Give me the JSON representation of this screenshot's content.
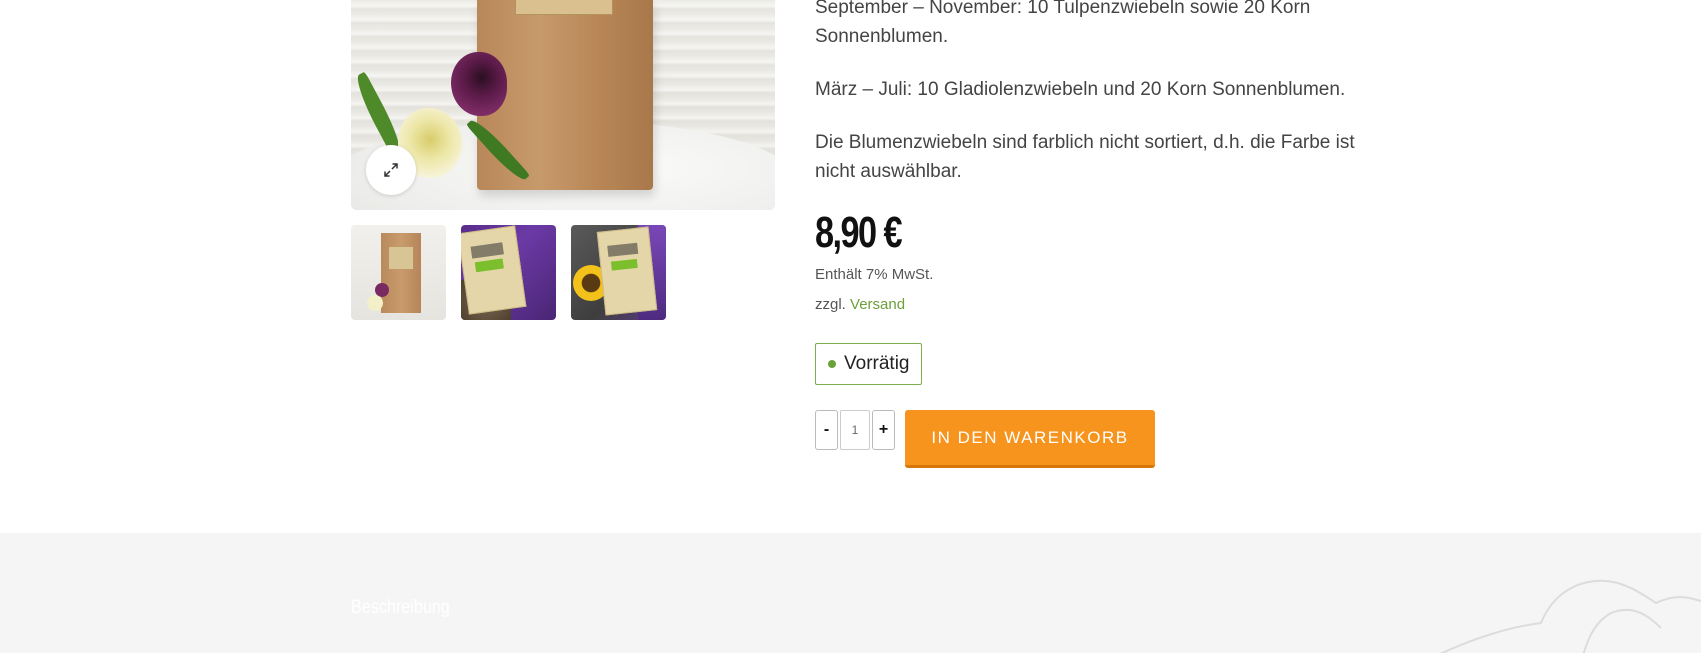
{
  "gallery": {
    "main_image_alt": "Papiertüte mit Tulpen",
    "zoom_icon": "expand-icon",
    "thumbnails": [
      {
        "alt": "Papiertüte mit Tulpen"
      },
      {
        "alt": "Karte mit Gladiolen"
      },
      {
        "alt": "Karte mit Sonnenblume und Gladiolen"
      }
    ]
  },
  "product": {
    "description": [
      "September – November: 10 Tulpenzwiebeln sowie 20 Korn Sonnenblumen.",
      "März – Juli: 10 Gladiolenzwiebeln und 20 Korn Sonnenblumen.",
      "Die Blumenzwiebeln sind farblich nicht sortiert, d.h. die Farbe ist nicht auswählbar."
    ],
    "price": "8,90 €",
    "tax_note": "Enthält 7% MwSt.",
    "shipping_prefix": "zzgl.",
    "shipping_link": "Versand",
    "stock_status": "Vorrätig",
    "quantity": {
      "minus_label": "-",
      "value": "1",
      "plus_label": "+"
    },
    "add_to_cart_label": "IN DEN WARENKORB"
  },
  "tabs": {
    "description_tab": "Beschreibung"
  },
  "colors": {
    "accent_green": "#6ba03a",
    "cart_orange": "#f7941d",
    "footer_bg": "#f5f5f5"
  }
}
